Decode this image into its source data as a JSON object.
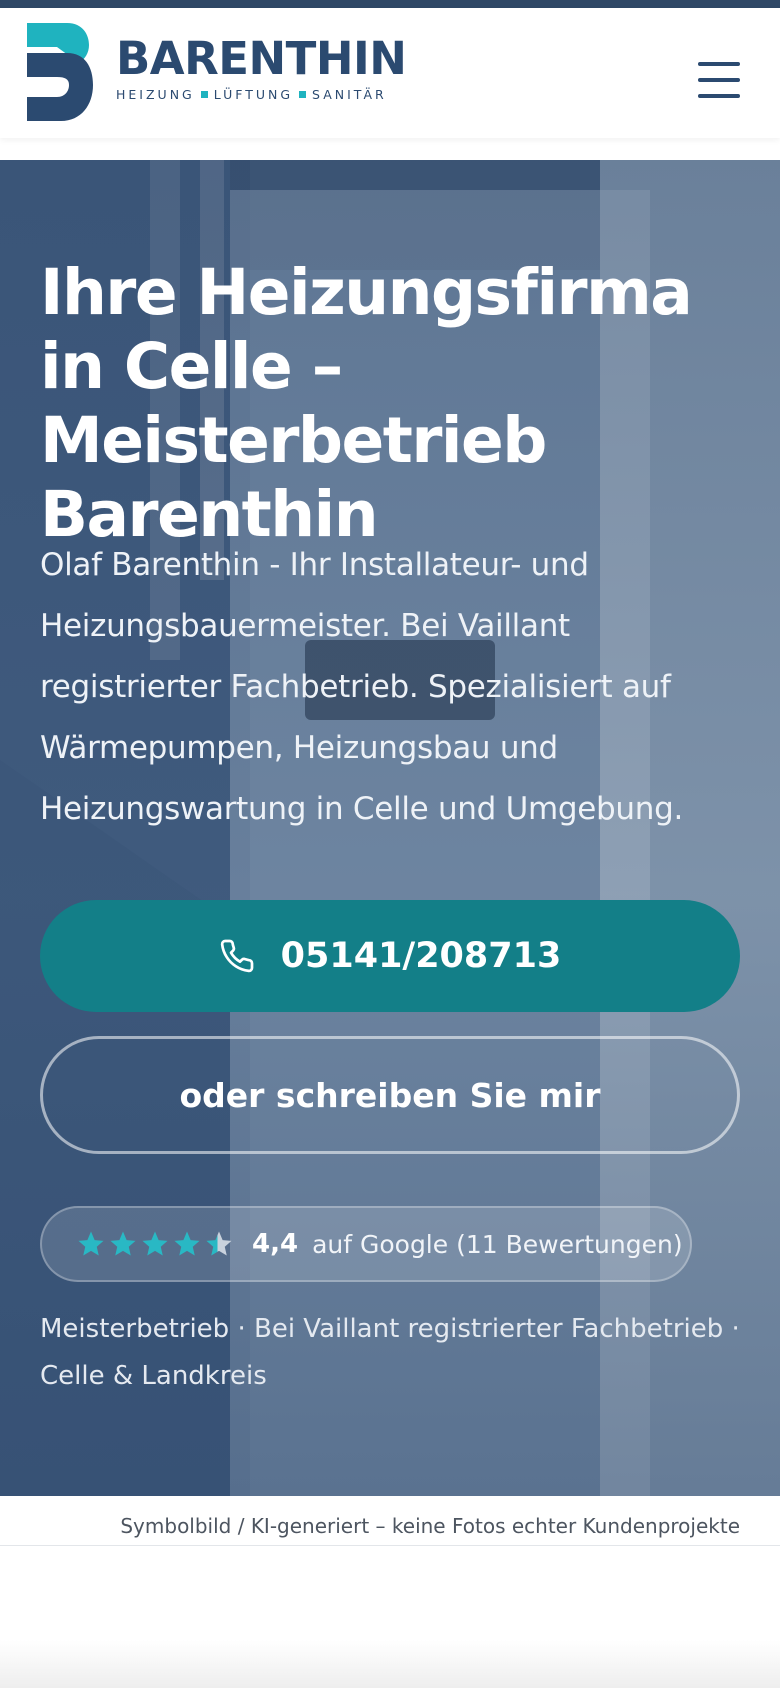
{
  "header": {
    "brand_name": "BARENTHIN",
    "tagline": [
      "HEIZUNG",
      "LÜFTUNG",
      "SANITÄR"
    ],
    "menu_icon": "hamburger-menu-icon"
  },
  "hero": {
    "title": "Ihre Heizungsfirma in Celle – Meisterbetrieb Barenthin",
    "description": "Olaf Barenthin - Ihr Installateur- und Heizungsbauermeister. Bei Vaillant registrierter Fachbetrieb. Spezialisiert auf Wärmepumpen, Heizungsbau und Heizungswartung in Celle und Umgebung.",
    "phone_button": {
      "label": "05141/208713",
      "icon": "phone-icon"
    },
    "write_button": {
      "label": "oder schreiben Sie mir"
    },
    "rating": {
      "score": "4,4",
      "value": 4.4,
      "max": 5,
      "text": "auf Google (11 Bewertungen)"
    },
    "trust_line": "Meisterbetrieb · Bei Vaillant registrierter Fachbetrieb · Celle & Landkreis"
  },
  "caption": "Symbolbild / KI-generiert – keine Fotos echter Kundenprojekte",
  "colors": {
    "brand_dark": "#2b4a70",
    "brand_accent": "#1fb3bf",
    "cta_teal": "#137f88",
    "star": "#29b8c4"
  }
}
